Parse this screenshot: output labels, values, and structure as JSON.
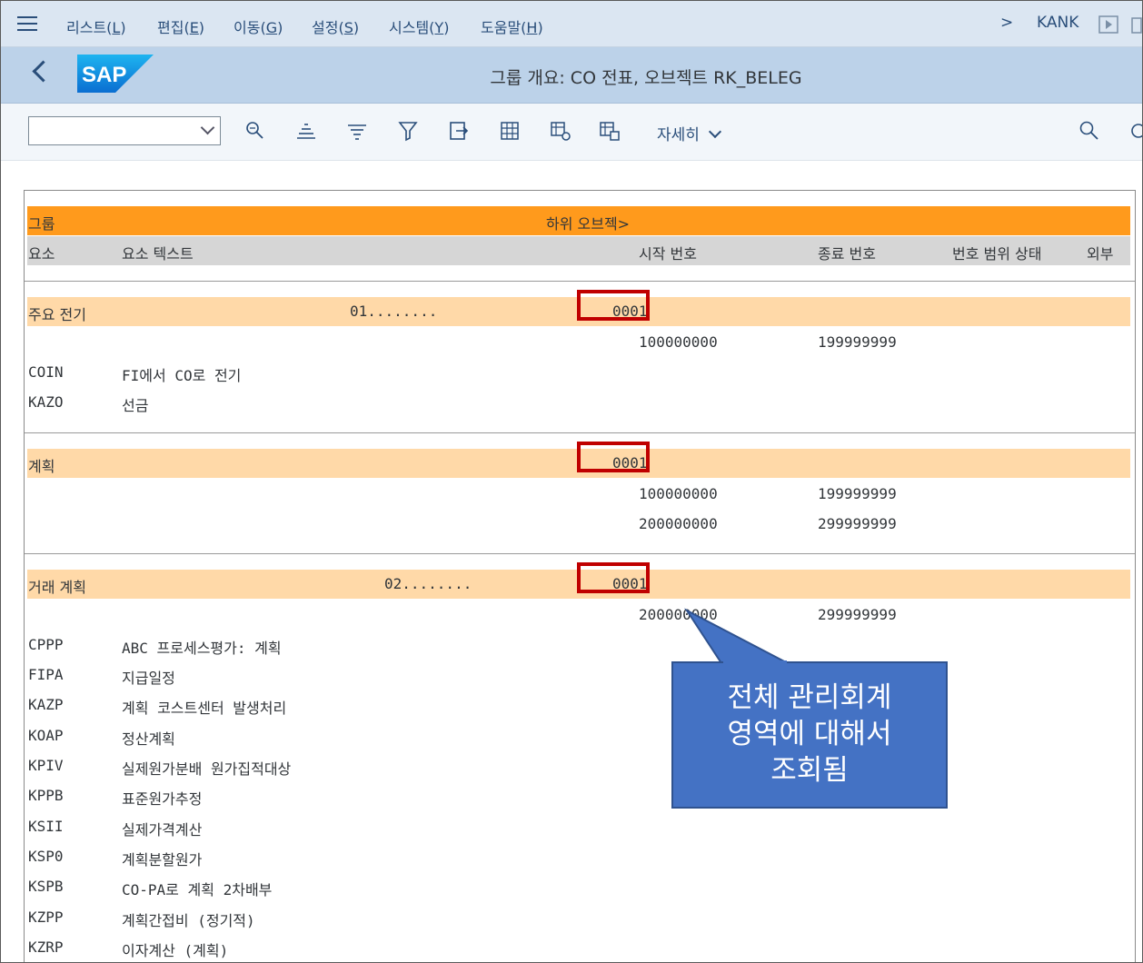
{
  "menu": {
    "items": [
      {
        "label": "리스트(",
        "key": "L",
        "end": ")"
      },
      {
        "label": "편집(",
        "key": "E",
        "end": ")"
      },
      {
        "label": "이동(",
        "key": "G",
        "end": ")"
      },
      {
        "label": "설정(",
        "key": "S",
        "end": ")"
      },
      {
        "label": "시스템(",
        "key": "Y",
        "end": ")"
      },
      {
        "label": "도움말(",
        "key": "H",
        "end": ")"
      }
    ],
    "more": ">",
    "user": "KANK"
  },
  "titlebar": {
    "logo": "SAP",
    "title": "그룹 개요: CO 전표, 오브젝트 RK_BELEG"
  },
  "toolbar": {
    "detail_label": "자세히"
  },
  "list": {
    "header1": {
      "col1": "그룹",
      "col2": "하위 오브젝>"
    },
    "header2": {
      "col1": "요소",
      "col2": "요소 텍스트",
      "col3": "시작 번호",
      "col4": "종료 번호",
      "col5": "번호 범위 상태",
      "col6": "외부"
    },
    "group1": {
      "name": "주요 전기",
      "code": "01........",
      "sub": "0001",
      "range": {
        "from": "100000000",
        "to": "199999999"
      },
      "elements": [
        {
          "code": "COIN",
          "text": "FI에서 CO로 전기"
        },
        {
          "code": "KAZO",
          "text": "선금"
        }
      ]
    },
    "group2": {
      "name": "계획",
      "sub": "0001",
      "ranges": [
        {
          "from": "100000000",
          "to": "199999999"
        },
        {
          "from": "200000000",
          "to": "299999999"
        }
      ]
    },
    "group3": {
      "name": "거래 계획",
      "code": "02........",
      "sub": "0001",
      "range": {
        "from": "200000000",
        "to": "299999999"
      },
      "elements": [
        {
          "code": "CPPP",
          "text": "ABC 프로세스평가: 계획"
        },
        {
          "code": "FIPA",
          "text": "지급일정"
        },
        {
          "code": "KAZP",
          "text": "계획 코스트센터 발생처리"
        },
        {
          "code": "KOAP",
          "text": "정산계획"
        },
        {
          "code": "KPIV",
          "text": "실제원가분배 원가집적대상"
        },
        {
          "code": "KPPB",
          "text": "표준원가추정"
        },
        {
          "code": "KSII",
          "text": "실제가격계산"
        },
        {
          "code": "KSP0",
          "text": "계획분할원가"
        },
        {
          "code": "KSPB",
          "text": "CO-PA로 계획 2차배부"
        },
        {
          "code": "KZPP",
          "text": "계획간접비 (정기적)"
        },
        {
          "code": "KZRP",
          "text": "이자계산 (계획)"
        }
      ]
    }
  },
  "callout": {
    "line1": "전체 관리회계",
    "line2": "영역에 대해서",
    "line3": "조회됨"
  },
  "colors": {
    "group_header": "#ff9a1c",
    "group_row": "#ffd9a8",
    "highlight": "#c00000",
    "callout": "#4472c4"
  }
}
